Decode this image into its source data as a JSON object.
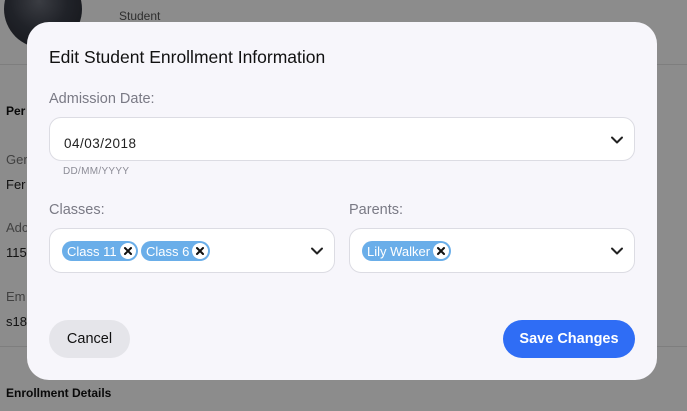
{
  "background": {
    "role": "Student",
    "section_partial": "Per",
    "gender_label_partial": "Ger",
    "gender_value_partial": "Fer",
    "address_label_partial": "Adc",
    "address_value_partial": "115",
    "email_label_partial": "Em",
    "email_value_partial": "s18",
    "enrollment_heading": "Enrollment Details"
  },
  "modal": {
    "title": "Edit Student Enrollment Information",
    "admission": {
      "label": "Admission Date:",
      "value": "04/03/2018",
      "hint": "DD/MM/YYYY"
    },
    "classes": {
      "label": "Classes:",
      "chips": [
        "Class 11",
        "Class 6"
      ]
    },
    "parents": {
      "label": "Parents:",
      "chips": [
        "Lily Walker"
      ]
    },
    "buttons": {
      "cancel": "Cancel",
      "save": "Save Changes"
    }
  },
  "colors": {
    "accent": "#2f6df5",
    "chip": "#6aaee9",
    "overlay": "rgba(0,0,0,0.45)"
  },
  "icons": {
    "dropdown": "chevron-down-icon",
    "remove": "close-icon"
  }
}
